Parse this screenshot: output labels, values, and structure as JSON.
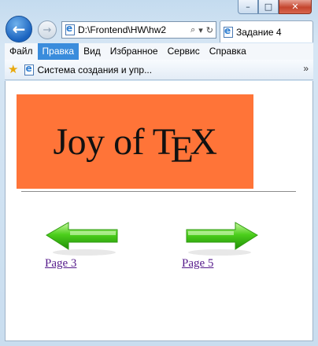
{
  "window": {
    "controls": {
      "minimize": "–",
      "maximize": "□",
      "close": "✕"
    }
  },
  "nav": {
    "back_icon": "←",
    "forward_icon": "→",
    "address": "D:\\Frontend\\HW\\hw2",
    "search_icon": "⌕",
    "dropdown_icon": "▾",
    "refresh_icon": "↻"
  },
  "tab": {
    "title": "Задание 4"
  },
  "menubar": {
    "items": [
      "Файл",
      "Правка",
      "Вид",
      "Избранное",
      "Сервис",
      "Справка"
    ],
    "active_index": 1
  },
  "favorites": {
    "star_icon": "★",
    "item": "Система создания и упр...",
    "more_icon": "»"
  },
  "page": {
    "logo": {
      "part1": "Joy of T",
      "part2": "E",
      "part3": "X"
    },
    "banner_color": "#ff7438",
    "arrow_color": "#33bb11",
    "prev_link": "Page 3",
    "next_link": "Page 5"
  }
}
